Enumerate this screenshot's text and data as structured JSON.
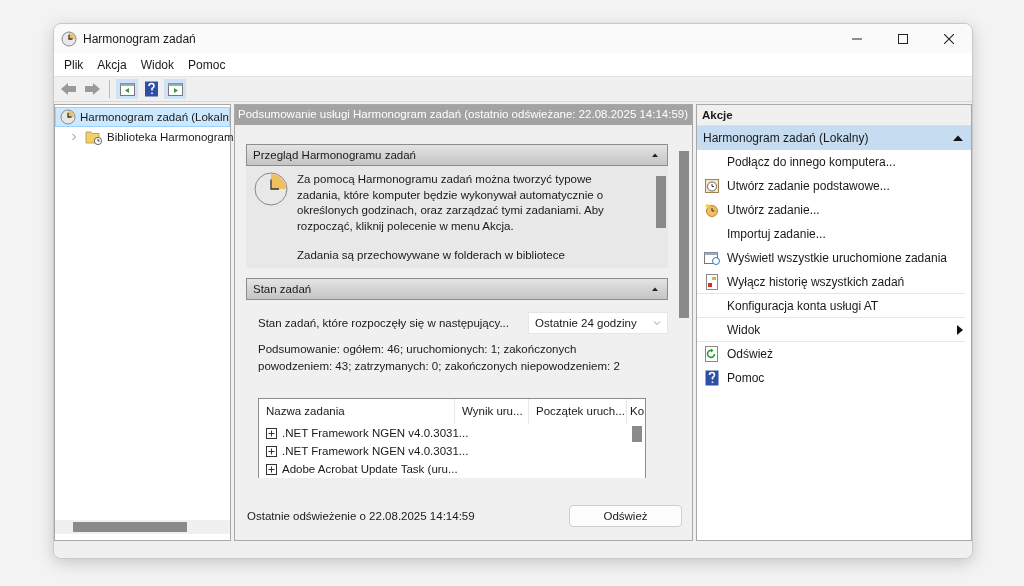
{
  "window": {
    "title": "Harmonogram zadań"
  },
  "menu": [
    "Plik",
    "Akcja",
    "Widok",
    "Pomoc"
  ],
  "toolbar": [
    {
      "kind": "back",
      "disabled": true
    },
    {
      "kind": "forward",
      "disabled": true
    },
    {
      "kind": "pane-left",
      "selected": true
    },
    {
      "kind": "help",
      "selected": false
    },
    {
      "kind": "pane-right",
      "selected": true
    }
  ],
  "tree": [
    {
      "label": "Harmonogram zadań (Lokaln",
      "selected": true,
      "children": [
        {
          "label": "Biblioteka Harmonogram",
          "selected": false,
          "expanded": false
        }
      ]
    }
  ],
  "summary_header": "Podsumowanie usługi Harmonogram zadań (ostatnio odświeżane: 22.08.2025 14:14:59)",
  "overview": {
    "title": "Przegląd Harmonogramu zadań",
    "expanded": true,
    "paragraphs": [
      "Za pomocą Harmonogramu zadań można tworzyć typowe zadania, które komputer będzie wykonywał automatycznie o określonych godzinach, oraz zarządzać tymi zadaniami. Aby rozpocząć, kliknij polecenie w menu Akcja.",
      "Zadania są przechowywane w folderach w bibliotece"
    ]
  },
  "task_status": {
    "title": "Stan zadań",
    "expanded": true,
    "filter_label": "Stan zadań, które rozpoczęły się w następujący...",
    "filter_value": "Ostatnie 24 godziny",
    "summary": "Podsumowanie: ogółem: 46; uruchomionych: 1; zakończonych powodzeniem: 43; zatrzymanych: 0; zakończonych niepowodzeniem: 2",
    "table": {
      "columns": [
        "Nazwa zadania",
        "Wynik uru...",
        "Początek uruch...",
        "Ko"
      ],
      "rows": [
        {
          "name": ".NET Framework NGEN v4.0.3031...",
          "expanded": false
        },
        {
          "name": ".NET Framework NGEN v4.0.3031...",
          "expanded": false
        },
        {
          "name": "Adobe Acrobat Update Task (uru...",
          "expanded": false
        }
      ]
    }
  },
  "footer": {
    "text": "Ostatnie odświeżenie o 22.08.2025 14:14:59",
    "button": "Odśwież"
  },
  "actions": {
    "title": "Akcje",
    "group": {
      "title": "Harmonogram zadań (Lokalny)",
      "expanded": true
    },
    "items": [
      {
        "label": "Podłącz do innego komputera...",
        "kind": "action",
        "divider": false
      },
      {
        "label": "Utwórz zadanie podstawowe...",
        "kind": "action",
        "divider": false
      },
      {
        "label": "Utwórz zadanie...",
        "kind": "action",
        "divider": false
      },
      {
        "label": "Importuj zadanie...",
        "kind": "action",
        "divider": false
      },
      {
        "label": "Wyświetl wszystkie uruchomione zadania",
        "kind": "action",
        "divider": false
      },
      {
        "label": "Wyłącz historię wszystkich zadań",
        "kind": "action",
        "divider": true
      },
      {
        "label": "Konfiguracja konta usługi AT",
        "kind": "action",
        "divider": true
      },
      {
        "label": "Widok",
        "kind": "submenu",
        "divider": true
      },
      {
        "label": "Odśwież",
        "kind": "action",
        "divider": false
      },
      {
        "label": "Pomoc",
        "kind": "action",
        "divider": false
      }
    ]
  }
}
